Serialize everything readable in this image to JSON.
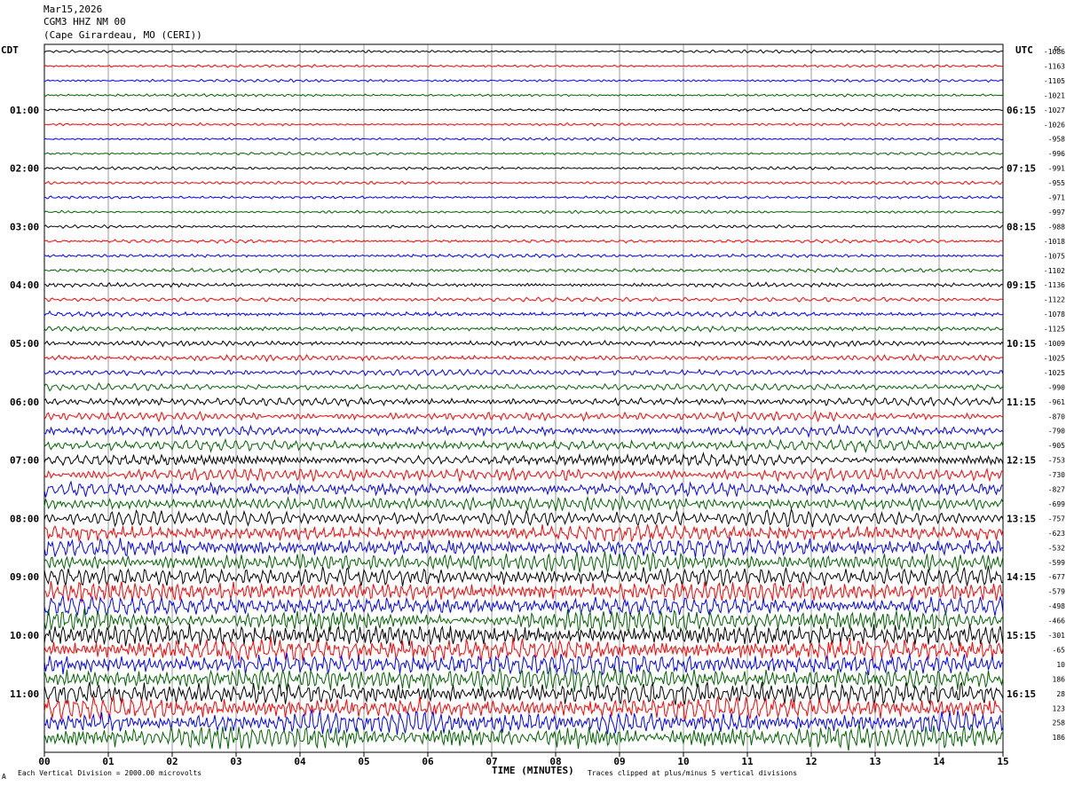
{
  "header": {
    "date": "Mar15,2026",
    "station": "CGM3 HHZ NM 00",
    "location": "(Cape Girardeau, MO (CERI))"
  },
  "left_zone": "CDT",
  "right_zone": "UTC",
  "dc_label": "DC",
  "footer": {
    "scale": "Each Vertical Division = 2000.00 microvolts",
    "xtitle": "TIME (MINUTES)",
    "clip": "Traces clipped at plus/minus 5 vertical divisions",
    "mark": "A"
  },
  "trace_colors": [
    "#000000",
    "#ff0000",
    "#0000ff",
    "#006400"
  ],
  "grid_color": "#000000",
  "chart_data": {
    "type": "line",
    "title": "CGM3 HHZ NM 00",
    "xlabel": "TIME (MINUTES)",
    "xlim": [
      0,
      15
    ],
    "x_ticks": [
      "00",
      "01",
      "02",
      "03",
      "04",
      "05",
      "06",
      "07",
      "08",
      "09",
      "10",
      "11",
      "12",
      "13",
      "14",
      "15"
    ],
    "left_hour_labels": [
      "01:00",
      "02:00",
      "03:00",
      "04:00",
      "05:00",
      "06:00",
      "07:00",
      "08:00",
      "09:00",
      "10:00",
      "11:00"
    ],
    "right_hour_labels": [
      "06:15",
      "07:15",
      "08:15",
      "09:15",
      "10:15",
      "11:15",
      "12:15",
      "13:15",
      "14:15",
      "15:15",
      "16:15"
    ],
    "trace_count": 48,
    "dc_offsets": [
      -1086,
      -1163,
      -1105,
      -1021,
      -1027,
      -1026,
      -958,
      -996,
      -991,
      -955,
      -971,
      -997,
      -988,
      -1018,
      -1075,
      -1102,
      -1136,
      -1122,
      -1078,
      -1125,
      -1009,
      -1025,
      -1025,
      -990,
      -961,
      -870,
      -790,
      -905,
      -753,
      -730,
      -827,
      -699,
      -757,
      -623,
      -532,
      -599,
      -677,
      -579,
      -498,
      -466,
      -301,
      -65,
      10,
      186,
      28,
      123,
      258,
      186
    ],
    "relative_amplitude": [
      0.12,
      0.12,
      0.12,
      0.12,
      0.12,
      0.12,
      0.12,
      0.12,
      0.13,
      0.13,
      0.13,
      0.13,
      0.14,
      0.15,
      0.16,
      0.17,
      0.18,
      0.2,
      0.21,
      0.22,
      0.24,
      0.25,
      0.27,
      0.3,
      0.35,
      0.38,
      0.42,
      0.48,
      0.52,
      0.55,
      0.58,
      0.62,
      0.68,
      0.72,
      0.78,
      0.82,
      0.85,
      0.88,
      0.9,
      0.92,
      0.95,
      0.98,
      1.0,
      1.0,
      1.0,
      1.0,
      1.0,
      1.0
    ],
    "grid": true,
    "clip_divisions": 5,
    "division_microvolts": 2000
  }
}
